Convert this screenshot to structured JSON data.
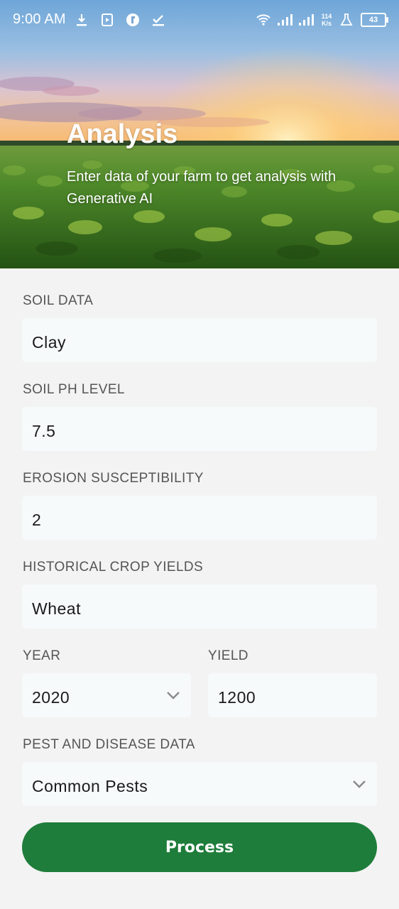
{
  "status_bar": {
    "time": "9:00 AM",
    "net_speed_value": "114",
    "net_speed_unit": "K/s",
    "battery": "43"
  },
  "hero": {
    "title": "Analysis",
    "subtitle": "Enter data of your farm to get analysis with Generative AI"
  },
  "form": {
    "soil_data": {
      "label": "SOIL DATA",
      "value": "Clay"
    },
    "soil_ph": {
      "label": "SOIL PH LEVEL",
      "value": "7.5"
    },
    "erosion": {
      "label": "EROSION SUSCEPTIBILITY",
      "value": "2"
    },
    "crop_yields": {
      "label": "HISTORICAL CROP YIELDS",
      "value": "Wheat"
    },
    "year": {
      "label": "YEAR",
      "value": "2020"
    },
    "yield": {
      "label": "YIELD",
      "value": "1200"
    },
    "pest": {
      "label": "PEST AND DISEASE DATA",
      "value": "Common Pests"
    },
    "process_label": "Process"
  },
  "colors": {
    "accent": "#1e7d3a",
    "background": "#f3f3f3",
    "field_bg": "#f7fafb",
    "label": "#555555"
  }
}
